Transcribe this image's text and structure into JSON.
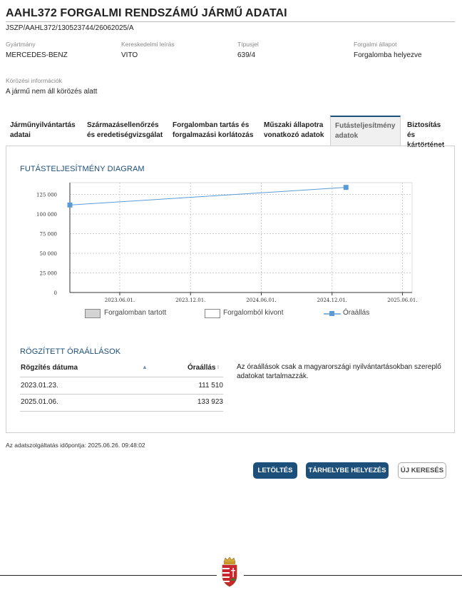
{
  "header": {
    "title": "AAHL372 FORGALMI RENDSZÁMÚ JÁRMŰ ADATAI",
    "reference": "JSZP/AAHL372/130523744/26062025/A"
  },
  "vehicle": {
    "manufacturer_label": "Gyártmány",
    "manufacturer": "MERCEDES-BENZ",
    "model_label": "Kereskedelmi leírás",
    "model": "VITO",
    "type_label": "Típusjel",
    "type": "639/4",
    "status_label": "Forgalmi állapot",
    "status": "Forgalomba helyezve",
    "wanted_label": "Körözési információk",
    "wanted": "A jármű nem áll körözés alatt"
  },
  "tabs": [
    {
      "line1": "Járműnyilvántartás",
      "line2": "adatai"
    },
    {
      "line1": "Származásellenőrzés",
      "line2": "és eredetiségvizsgálat"
    },
    {
      "line1": "Forgalomban tartás és",
      "line2": "forgalmazási korlátozás"
    },
    {
      "line1": "Műszaki állapotra",
      "line2": "vonatkozó adatok"
    },
    {
      "line1": "Futásteljesítmény",
      "line2": "adatok"
    },
    {
      "line1": "Biztosítás és",
      "line2": "kártörténet"
    }
  ],
  "active_tab": "Futásteljesítmény adatok",
  "diagram": {
    "heading": "FUTÁSTELJESÍTMÉNY DIAGRAM"
  },
  "chart_data": {
    "type": "line",
    "title": "FUTÁSTELJESÍTMÉNY DIAGRAM",
    "xlabel": "",
    "ylabel": "",
    "x_ticks": [
      "2023.06.01.",
      "2023.12.01.",
      "2024.06.01.",
      "2024.12.01.",
      "2025.06.01."
    ],
    "y_ticks": [
      "0",
      "25 000",
      "50 000",
      "75 000",
      "100 000",
      "125 000"
    ],
    "ylim": [
      0,
      140000
    ],
    "xlim": [
      "2023.01.23.",
      "2025.06.26."
    ],
    "grid": true,
    "series": [
      {
        "name": "Óraállás",
        "color": "#5b9bd5",
        "x": [
          "2023.01.23.",
          "2025.01.06."
        ],
        "values": [
          111510,
          133923
        ]
      }
    ],
    "legend": [
      {
        "label": "Forgalomban tartott",
        "kind": "box",
        "color": "#d4d4d4"
      },
      {
        "label": "Forgalomból kivont",
        "kind": "box",
        "color": "#ffffff"
      },
      {
        "label": "Óraállás",
        "kind": "line",
        "color": "#5b9bd5"
      }
    ],
    "legend_position": "bottom"
  },
  "readings": {
    "heading": "RÖGZÍTETT ÓRAÁLLÁSOK",
    "col_date": "Rögzítés dátuma",
    "col_value": "Óraállás",
    "rows": [
      {
        "date": "2023.01.23.",
        "value": "111 510"
      },
      {
        "date": "2025.01.06.",
        "value": "133 923"
      }
    ],
    "note": "Az óraállások csak a magyarországi nyilvántartásokban szereplő adatokat tartalmazzák."
  },
  "footer": {
    "timestamp": "Az adatszolgáltatás időpontja: 2025.06.26. 09:48:02",
    "download": "LETÖLTÉS",
    "store": "TÁRHELYBE HELYEZÉS",
    "new_search": "ÚJ KERESÉS"
  },
  "colors": {
    "accent": "#1c4f7a",
    "series": "#5b9bd5"
  }
}
